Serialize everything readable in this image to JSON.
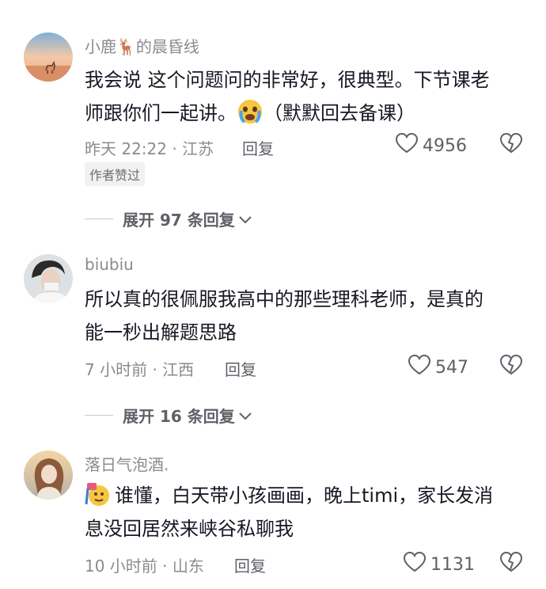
{
  "comments": [
    {
      "username": "小鹿🦌的晨昏线",
      "line1": "我会说 这个问题问的非常好，很典型。下节课老",
      "line2a": "师跟你们一起讲。",
      "line2b": "（默默回去备课）",
      "meta": "昨天 22:22 · 江苏",
      "reply": "回复",
      "likes": "4956",
      "badge": "作者赞过",
      "expand": "展开 97 条回复"
    },
    {
      "username": "biubiu",
      "line1": "所以真的很佩服我高中的那些理科老师，是真的",
      "line2": "能一秒出解题思路",
      "meta": "7 小时前 · 江西",
      "reply": "回复",
      "likes": "547",
      "expand": "展开 16 条回复"
    },
    {
      "username": "落日气泡酒.",
      "line1": "谁懂，白天带小孩画画，晚上timi，家长发消",
      "line2": "息没回居然来峡谷私聊我",
      "meta": "10 小时前 · 山东",
      "reply": "回复",
      "likes": "1131"
    }
  ],
  "icons": {
    "like": "heart-outline-icon",
    "dislike": "broken-heart-icon",
    "expand": "chevron-down-icon"
  },
  "colors": {
    "text": "#161823",
    "secondary": "#8a8b91",
    "action": "#5f6068"
  }
}
